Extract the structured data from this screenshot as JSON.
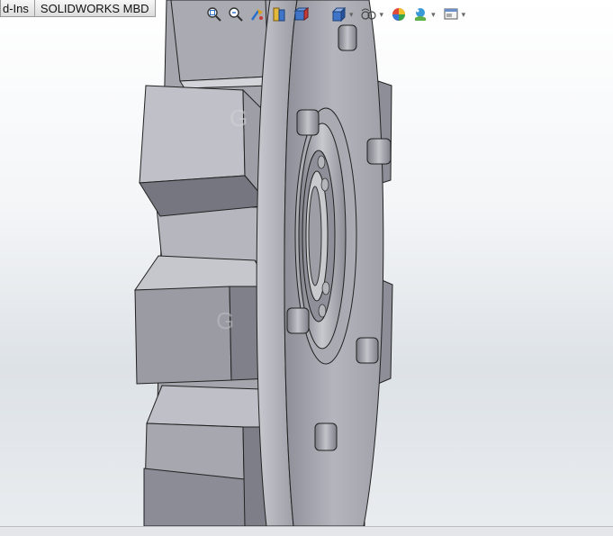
{
  "tabs": [
    {
      "label": "d-Ins"
    },
    {
      "label": "SOLIDWORKS MBD"
    }
  ],
  "heads_up_toolbar": {
    "tools": [
      {
        "icon": "zoom-to-fit-icon"
      },
      {
        "icon": "zoom-to-area-icon"
      },
      {
        "icon": "previous-view-icon"
      },
      {
        "icon": "section-view-icon"
      },
      {
        "icon": "dynamic-annotation-views-icon"
      },
      {
        "icon": "view-orientation-icon"
      },
      {
        "icon": "display-style-icon"
      },
      {
        "icon": "hide-show-items-icon"
      },
      {
        "icon": "edit-appearance-icon"
      },
      {
        "icon": "apply-scene-icon"
      },
      {
        "icon": "view-settings-icon"
      }
    ]
  },
  "colors": {
    "model_face_light": "#bbbcc4",
    "model_face_mid": "#9c9da6",
    "model_face_dark": "#6d6e77",
    "viewport_top": "#ffffff",
    "viewport_bottom": "#dde2e7"
  }
}
